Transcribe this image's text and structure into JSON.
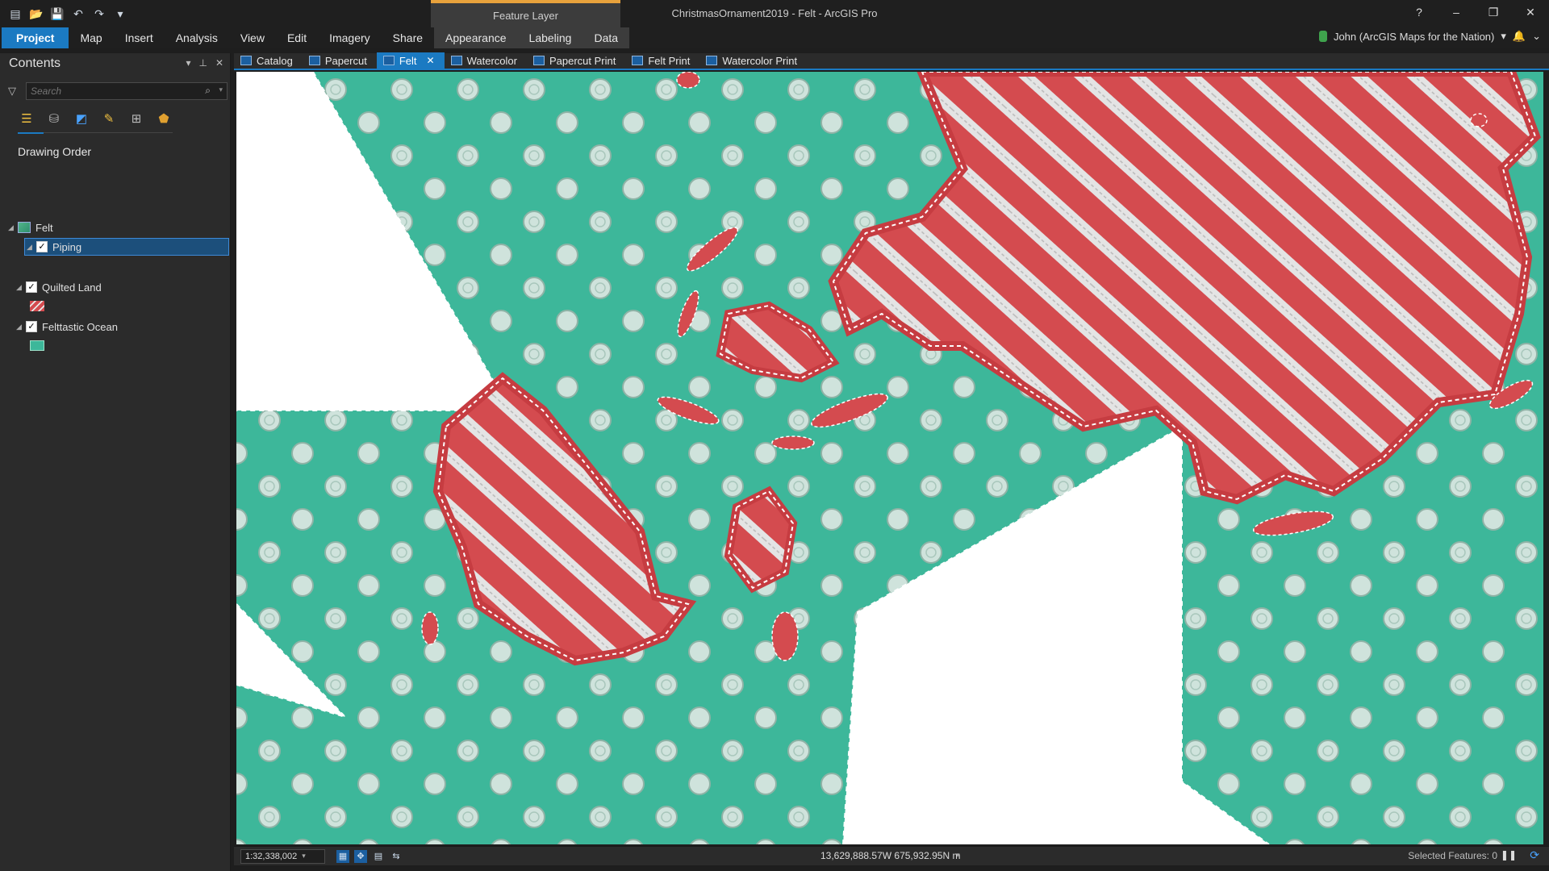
{
  "window": {
    "title": "ChristmasOrnament2019 - Felt - ArcGIS Pro",
    "context_group": "Feature Layer",
    "help": "?",
    "minimize": "–",
    "restore": "❐",
    "close": "✕"
  },
  "qat": [
    "▤",
    "📂",
    "💾",
    "↶",
    "↷",
    "▾"
  ],
  "ribbon": {
    "tabs": [
      "Project",
      "Map",
      "Insert",
      "Analysis",
      "View",
      "Edit",
      "Imagery",
      "Share",
      "Appearance",
      "Labeling",
      "Data"
    ],
    "user": "John (ArcGIS Maps for the Nation)",
    "user_caret": "▾",
    "bell": "🔔",
    "chevron": "⌄"
  },
  "contents": {
    "title": "Contents",
    "search_placeholder": "Search",
    "drawing_order": "Drawing Order",
    "map_name": "Felt",
    "layers": [
      {
        "name": "Piping",
        "checked": true
      },
      {
        "name": "Quilted Land",
        "checked": true
      },
      {
        "name": "Felttastic Ocean",
        "checked": true
      }
    ]
  },
  "map_tabs": [
    "Catalog",
    "Papercut",
    "Felt",
    "Watercolor",
    "Papercut Print",
    "Felt Print",
    "Watercolor Print"
  ],
  "status": {
    "scale": "1:32,338,002",
    "coords": "13,629,888.57W 675,932.95N m",
    "selected": "Selected Features: 0"
  },
  "colors": {
    "ocean": "#3db79a",
    "land": "#d44b4f",
    "accent": "#1b7ac2",
    "context_orange": "#e8a23c"
  }
}
